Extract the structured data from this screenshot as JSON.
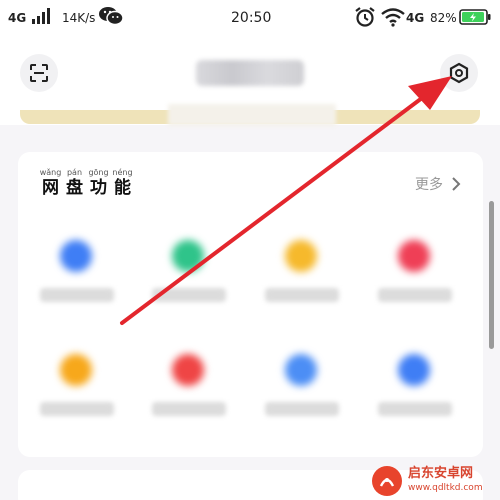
{
  "status_bar": {
    "network_left": "4G",
    "speed": "14K/s",
    "time": "20:50",
    "network_right": "4G",
    "battery_pct": "82%",
    "icons": [
      "signal-icon",
      "wechat-icon",
      "alarm-icon",
      "wifi-icon",
      "battery-icon"
    ]
  },
  "header": {
    "icons": [
      "scan-icon",
      "settings-icon"
    ]
  },
  "card": {
    "title_chars": [
      {
        "pinyin": "wǎng",
        "han": "网"
      },
      {
        "pinyin": "pán",
        "han": "盘"
      },
      {
        "pinyin": "gōng",
        "han": "功"
      },
      {
        "pinyin": "néng",
        "han": "能"
      }
    ],
    "more_label": "更多",
    "items": [
      {
        "icon_color": "#3f7ef5"
      },
      {
        "icon_color": "#2fc48a"
      },
      {
        "icon_color": "#f6b92c"
      },
      {
        "icon_color": "#ef3f56"
      },
      {
        "icon_color": "#f7a81b"
      },
      {
        "icon_color": "#ef4545"
      },
      {
        "icon_color": "#4c8ef5"
      },
      {
        "icon_color": "#3f7ef5"
      }
    ]
  },
  "colors": {
    "arrow": "#e3262d",
    "header_band": "#efe3b9"
  },
  "watermark": {
    "title": "启东安卓网",
    "url": "www.qdltkd.com"
  }
}
